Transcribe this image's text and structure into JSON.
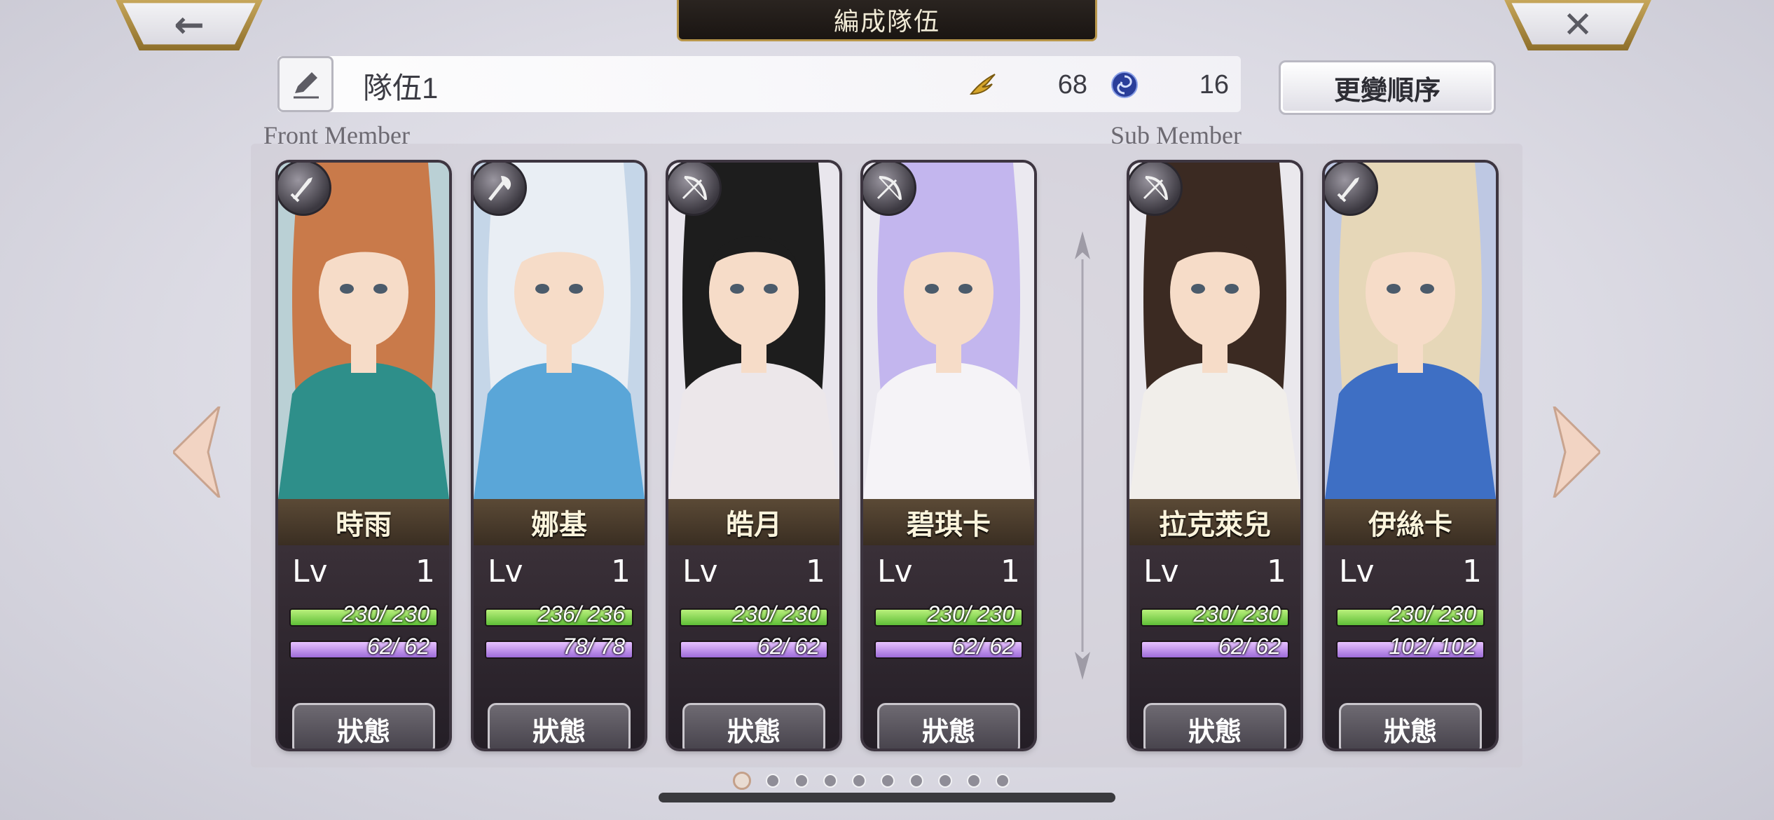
{
  "header": {
    "title": "編成隊伍",
    "back_icon": "←",
    "close_icon": "✕"
  },
  "party": {
    "name": "隊伍1",
    "resource1": {
      "icon": "gold-wing-icon",
      "value": "68"
    },
    "resource2": {
      "icon": "blue-swirl-icon",
      "value": "16"
    },
    "order_button": "更變順序"
  },
  "sections": {
    "front": "Front Member",
    "sub": "Sub Member"
  },
  "status_label": "狀態",
  "members": [
    {
      "name": "時雨",
      "lv_label": "Lv",
      "lv": "1",
      "hp": "230/ 230",
      "mp": "62/ 62",
      "class_icon": "sword-icon",
      "hair": "#c97a4a",
      "outfit": "#2e8f8a"
    },
    {
      "name": "娜基",
      "lv_label": "Lv",
      "lv": "1",
      "hp": "236/ 236",
      "mp": "78/ 78",
      "class_icon": "axe-icon",
      "hair": "#e9eef4",
      "outfit": "#5aa6d8"
    },
    {
      "name": "皓月",
      "lv_label": "Lv",
      "lv": "1",
      "hp": "230/ 230",
      "mp": "62/ 62",
      "class_icon": "bow-icon",
      "hair": "#1d1d1d",
      "outfit": "#ece7ea"
    },
    {
      "name": "碧琪卡",
      "lv_label": "Lv",
      "lv": "1",
      "hp": "230/ 230",
      "mp": "62/ 62",
      "class_icon": "bow-icon",
      "hair": "#c3b6ee",
      "outfit": "#f5f3f7"
    },
    {
      "name": "拉克萊兒",
      "lv_label": "Lv",
      "lv": "1",
      "hp": "230/ 230",
      "mp": "62/ 62",
      "class_icon": "bow-icon",
      "hair": "#3b2a22",
      "outfit": "#f1eeea"
    },
    {
      "name": "伊絲卡",
      "lv_label": "Lv",
      "lv": "1",
      "hp": "230/ 230",
      "mp": "102/ 102",
      "class_icon": "sword-icon",
      "hair": "#e6d7b8",
      "outfit": "#3e6fc4"
    }
  ],
  "pager": {
    "total": 10,
    "current": 1
  }
}
